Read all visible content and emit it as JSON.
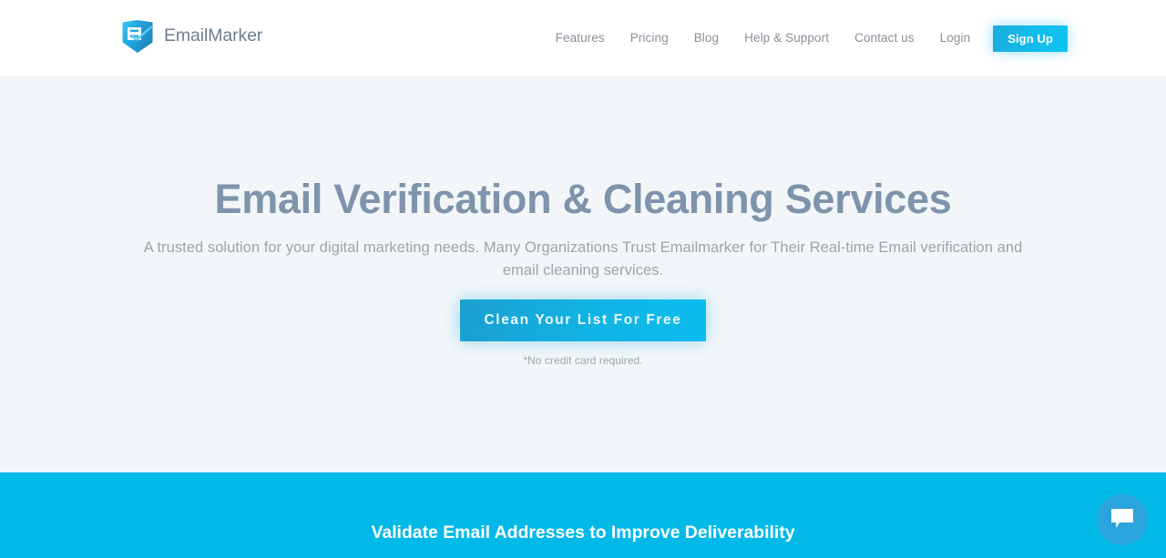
{
  "brand": {
    "name": "EmailMarker",
    "logo_icon": "shield-check-logo-icon",
    "logo_color": "#29b6e8"
  },
  "header": {
    "background": "#ffffff",
    "nav": [
      {
        "label": "Features"
      },
      {
        "label": "Pricing"
      },
      {
        "label": "Blog"
      },
      {
        "label": "Help & Support"
      },
      {
        "label": "Contact us"
      },
      {
        "label": "Login"
      }
    ],
    "signup_label": "Sign Up",
    "signup_color": "#14b9ea"
  },
  "hero": {
    "background": "#f2f6f9",
    "title": "Email Verification & Cleaning Services",
    "title_color": "#7f93ab",
    "subtitle": "A trusted solution for your digital marketing needs. Many Organizations Trust Emailmarker for Their Real-time Email verification and email cleaning services.",
    "cta_label": "Clean Your List For Free",
    "cta_color": "#10b4e4",
    "cta_note": "*No credit card required."
  },
  "band": {
    "background": "#02b9e8",
    "title": "Validate Email Addresses to Improve Deliverability"
  },
  "chat": {
    "icon": "chat-bubble-icon",
    "background": "#2aa4dd"
  }
}
